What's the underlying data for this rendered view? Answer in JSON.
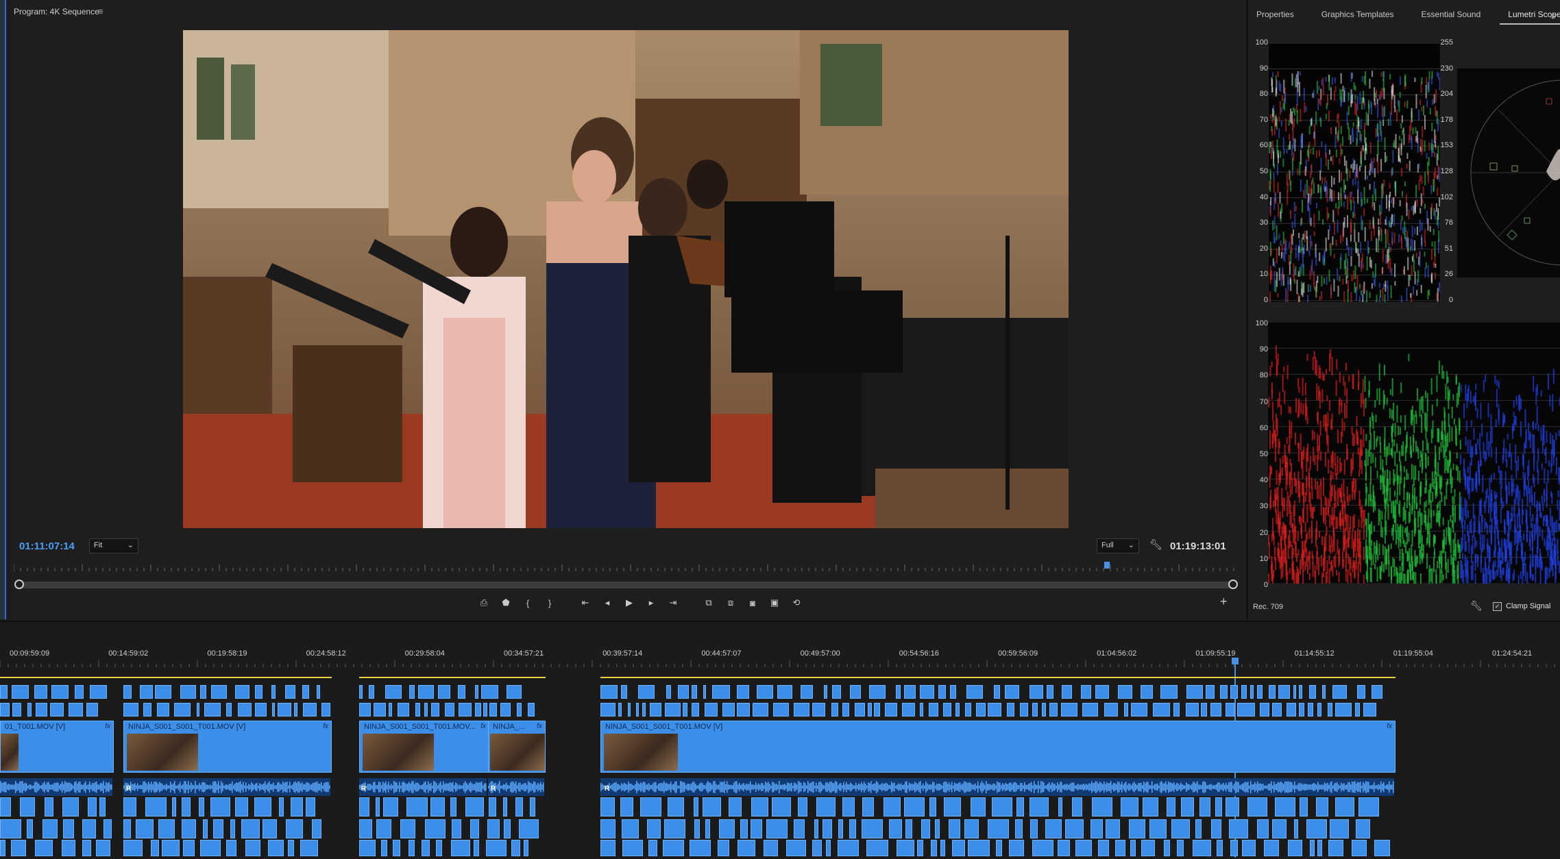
{
  "program": {
    "title": "Program: 4K Sequence",
    "menu_icon": "hamburger-icon",
    "timecode_current": "01:11:07:14",
    "timecode_duration": "01:19:13:01",
    "zoom": "Fit",
    "resolution": "Full"
  },
  "right_panel": {
    "tabs": [
      "Properties",
      "Graphics Templates",
      "Essential Sound",
      "Lumetri Scopes"
    ],
    "active_tab": "Lumetri Scopes",
    "waveform_left_scale": [
      "100",
      "90",
      "80",
      "70",
      "60",
      "50",
      "40",
      "30",
      "20",
      "10",
      "0"
    ],
    "waveform_right_scale": [
      "255",
      "230",
      "204",
      "178",
      "153",
      "128",
      "102",
      "76",
      "51",
      "26",
      "0"
    ],
    "parade_scale": [
      "100",
      "90",
      "80",
      "70",
      "60",
      "50",
      "40",
      "30",
      "20",
      "10",
      "0"
    ],
    "standard": "Rec. 709",
    "clamp_label": "Clamp Signal",
    "clamp_checked": "✓"
  },
  "timeline": {
    "timecodes": [
      "00:09:59:09",
      "00:14:59:02",
      "00:19:58:19",
      "00:24:58:12",
      "00:29:58:04",
      "00:34:57:21",
      "00:39:57:14",
      "00:44:57:07",
      "00:49:57:00",
      "00:54:56:16",
      "00:59:56:09",
      "01:04:56:02",
      "01:09:55:19",
      "01:14:55:12",
      "01:19:55:04",
      "01:24:54:21"
    ],
    "clips": [
      {
        "label": "01_T001.MOV [V]"
      },
      {
        "label": "NINJA_S001_S001_T001.MOV [V]"
      },
      {
        "label": "NINJA_S001_S001_T001.MOV..."
      },
      {
        "label": "NINJA_..."
      },
      {
        "label": "NINJA_S001_S001_T001.MOV [V]"
      }
    ],
    "fx_badge": "fx",
    "audio_badge": "R"
  },
  "colors": {
    "accent_blue": "#4d9ef5",
    "clip_blue": "#3d8ee8",
    "marker_yellow": "#e6d23a"
  }
}
